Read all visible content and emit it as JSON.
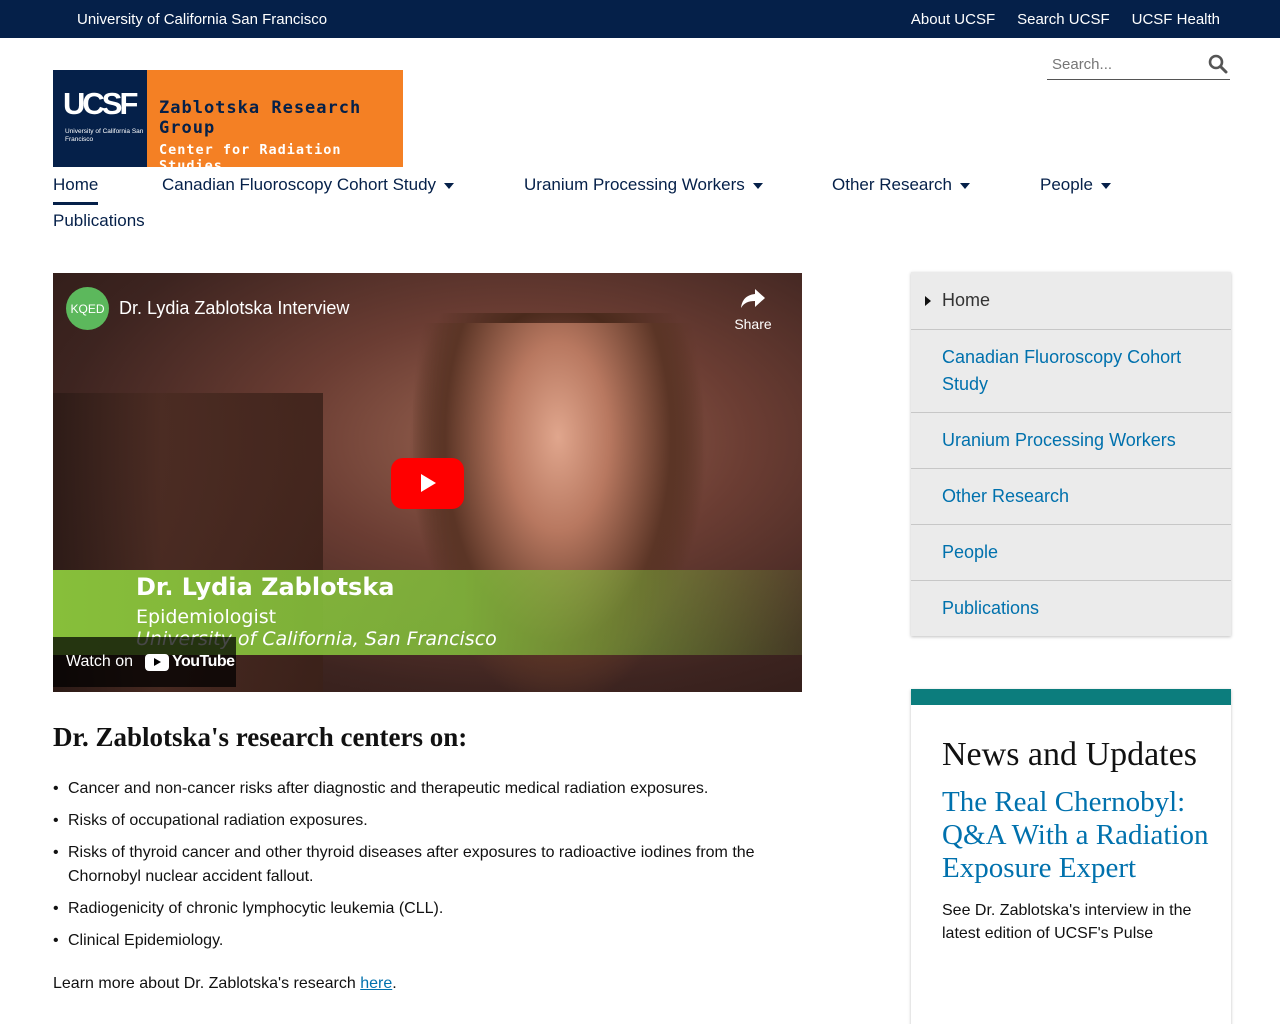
{
  "topbar": {
    "university": "University of California San Francisco",
    "links": [
      "About UCSF",
      "Search UCSF",
      "UCSF Health"
    ]
  },
  "logo": {
    "ucsf_mark": "UCSF",
    "ucsf_sub": "University of California San Francisco",
    "group_name": "Zablotska Research Group",
    "group_sub": "Center for Radiation Studies"
  },
  "search": {
    "placeholder": "Search..."
  },
  "nav": {
    "home": "Home",
    "canadian": "Canadian Fluoroscopy Cohort Study",
    "uranium": "Uranium Processing Workers",
    "other": "Other Research",
    "people": "People",
    "publications": "Publications"
  },
  "video": {
    "channel": "KQED",
    "title": "Dr. Lydia Zablotska Interview",
    "share": "Share",
    "name": "Dr. Lydia Zablotska",
    "role": "Epidemiologist",
    "org": "University of California, San Francisco",
    "watch_on": "Watch on",
    "youtube": "YouTube"
  },
  "main": {
    "heading": "Dr. Zablotska's research centers on:",
    "bullets": [
      "Cancer and non-cancer risks after diagnostic and therapeutic medical radiation exposures.",
      "Risks of occupational radiation exposures.",
      "Risks of thyroid cancer and other thyroid diseases after exposures to radioactive iodines from the Chornobyl nuclear accident fallout.",
      "Radiogenicity of chronic lymphocytic leukemia (CLL).",
      "Clinical Epidemiology."
    ],
    "learn_prefix": "Learn more about Dr. Zablotska's research ",
    "learn_link": "here",
    "learn_suffix": "."
  },
  "sidebar": {
    "items": [
      "Home",
      "Canadian Fluoroscopy Cohort Study",
      "Uranium Processing Workers",
      "Other Research",
      "People",
      "Publications"
    ]
  },
  "news": {
    "heading": "News and Updates",
    "article_title": "The Real Chernobyl: Q&A With a Radiation Exposure Expert",
    "article_text": "See Dr. Zablotska's interview in the latest edition of UCSF's Pulse"
  },
  "colors": {
    "navy": "#052049",
    "orange": "#f48024",
    "link_blue": "#0071ad",
    "teal": "#0c7d7d",
    "youtube_red": "#ff0000"
  }
}
